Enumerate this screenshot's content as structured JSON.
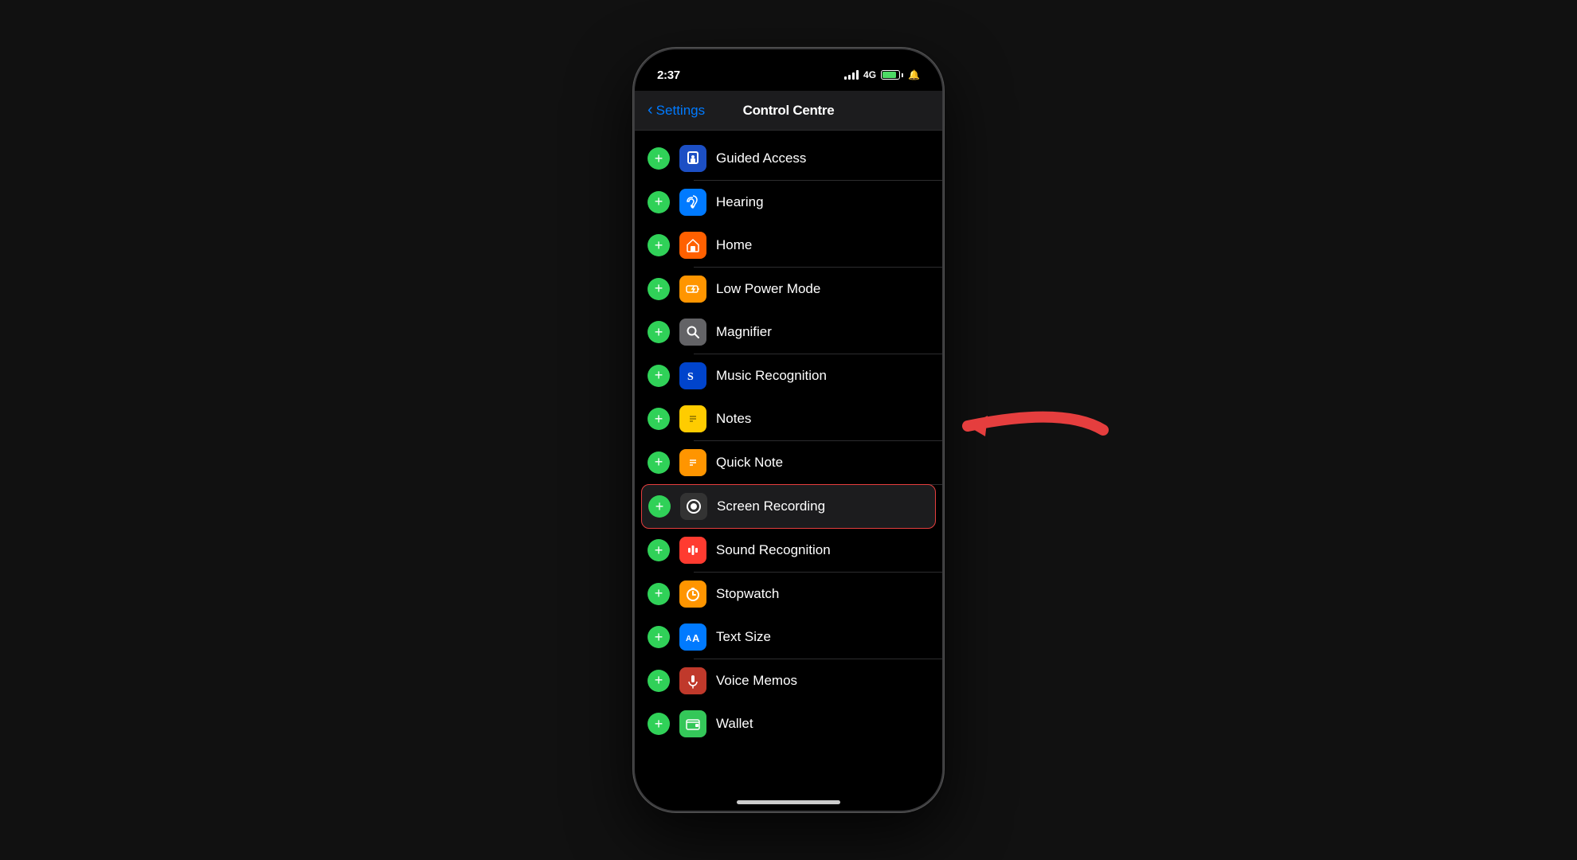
{
  "page": {
    "background": "#111111"
  },
  "statusBar": {
    "time": "2:37",
    "signal": "4G",
    "battery": "82"
  },
  "nav": {
    "backLabel": "Settings",
    "title": "Control Centre"
  },
  "items": [
    {
      "id": "guided-access",
      "label": "Guided Access",
      "iconBg": "icon-blue-dark",
      "iconChar": "🔒",
      "highlighted": false
    },
    {
      "id": "hearing",
      "label": "Hearing",
      "iconBg": "icon-blue",
      "iconChar": "👂",
      "highlighted": false
    },
    {
      "id": "home",
      "label": "Home",
      "iconBg": "icon-orange",
      "iconChar": "🏠",
      "highlighted": false
    },
    {
      "id": "low-power-mode",
      "label": "Low Power Mode",
      "iconBg": "icon-orange",
      "iconChar": "🔋",
      "highlighted": false
    },
    {
      "id": "magnifier",
      "label": "Magnifier",
      "iconBg": "icon-gray",
      "iconChar": "🔍",
      "highlighted": false
    },
    {
      "id": "music-recognition",
      "label": "Music Recognition",
      "iconBg": "icon-shazam",
      "iconChar": "S",
      "highlighted": false
    },
    {
      "id": "notes",
      "label": "Notes",
      "iconBg": "icon-yellow",
      "iconChar": "📝",
      "highlighted": false
    },
    {
      "id": "quick-note",
      "label": "Quick Note",
      "iconBg": "icon-orange2",
      "iconChar": "📋",
      "highlighted": false
    },
    {
      "id": "screen-recording",
      "label": "Screen Recording",
      "iconBg": "icon-red-white",
      "iconChar": "⏺",
      "highlighted": true
    },
    {
      "id": "sound-recognition",
      "label": "Sound Recognition",
      "iconBg": "icon-red-sound",
      "iconChar": "🎵",
      "highlighted": false
    },
    {
      "id": "stopwatch",
      "label": "Stopwatch",
      "iconBg": "icon-orange-stop",
      "iconChar": "⏱",
      "highlighted": false
    },
    {
      "id": "text-size",
      "label": "Text Size",
      "iconBg": "icon-blue-text",
      "iconChar": "Aa",
      "highlighted": false
    },
    {
      "id": "voice-memos",
      "label": "Voice Memos",
      "iconBg": "icon-red-voice",
      "iconChar": "🎙",
      "highlighted": false
    },
    {
      "id": "wallet",
      "label": "Wallet",
      "iconBg": "icon-green-wallet",
      "iconChar": "💳",
      "highlighted": false
    }
  ]
}
